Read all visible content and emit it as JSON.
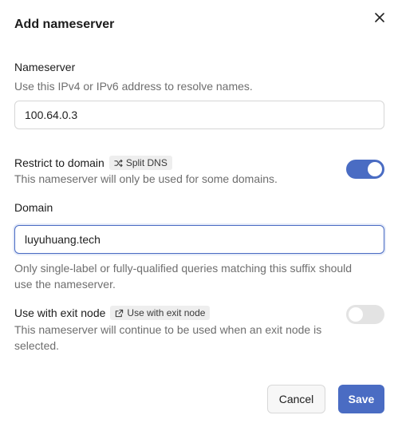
{
  "dialog": {
    "title": "Add nameserver"
  },
  "nameserver": {
    "label": "Nameserver",
    "help": "Use this IPv4 or IPv6 address to resolve names.",
    "value": "100.64.0.3"
  },
  "restrict": {
    "label": "Restrict to domain",
    "badge": "Split DNS",
    "badge_icon": "shuffle-icon",
    "help": "This nameserver will only be used for some domains.",
    "enabled": true
  },
  "domain": {
    "label": "Domain",
    "value": "luyuhuang.tech",
    "help_line1": "Only single-label or fully-qualified queries matching this suffix should",
    "help_line2": "use the nameserver."
  },
  "exit_node": {
    "label": "Use with exit node",
    "badge": "Use with exit node",
    "badge_icon": "external-link-icon",
    "help_line1": "This nameserver will continue to be used when an exit node is",
    "help_line2": "selected.",
    "enabled": false
  },
  "footer": {
    "cancel_label": "Cancel",
    "save_label": "Save"
  },
  "colors": {
    "accent": "#4a6cc3",
    "toggle_off": "#e3e3e3"
  }
}
